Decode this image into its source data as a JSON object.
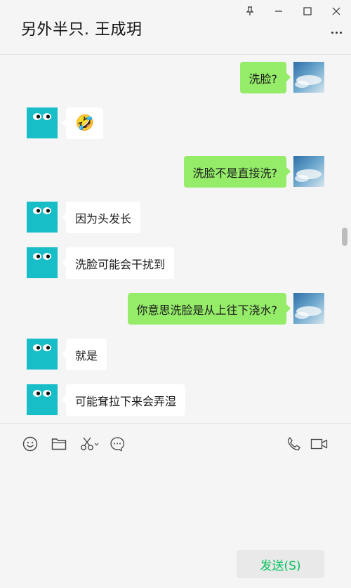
{
  "header": {
    "title": "另外半只. 王成玥",
    "pin_icon": "pin-icon",
    "minimize_icon": "minimize-icon",
    "maximize_icon": "maximize-icon",
    "close_icon": "close-icon",
    "more_icon": "more-dots-icon"
  },
  "messages": [
    {
      "side": "me",
      "text": "洗脸?"
    },
    {
      "side": "them",
      "text": "🤣"
    },
    {
      "side": "me",
      "text": "洗脸不是直接洗?"
    },
    {
      "side": "them",
      "text": "因为头发长"
    },
    {
      "side": "them",
      "text": "洗脸可能会干扰到"
    },
    {
      "side": "me",
      "text": "你意思洗脸是从上往下浇水?"
    },
    {
      "side": "them",
      "text": "就是"
    },
    {
      "side": "them",
      "text": "可能耷拉下来会弄湿"
    }
  ],
  "composer": {
    "tools": [
      "emoji-icon",
      "folder-icon",
      "scissors-icon",
      "chat-bubble-icon"
    ],
    "right_tools": [
      "phone-icon",
      "video-icon"
    ],
    "send_label": "发送(S)",
    "input_value": ""
  },
  "colors": {
    "my_bubble": "#95ec69",
    "their_bubble": "#ffffff",
    "their_avatar": "#18bec7",
    "send_text": "#07c160",
    "background": "#f5f5f5"
  }
}
